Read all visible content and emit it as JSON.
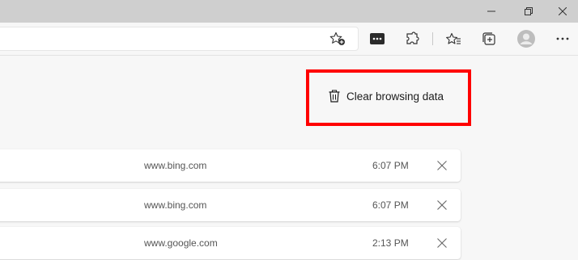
{
  "window_controls": {
    "minimize": "minimize-icon",
    "restore": "restore-icon",
    "close": "close-icon"
  },
  "toolbar": {
    "icons": [
      "favorite-add-icon",
      "password-manager-icon",
      "extensions-icon",
      "favorites-icon",
      "collections-icon",
      "profile-avatar-icon",
      "more-menu-icon"
    ]
  },
  "page": {
    "clear_label": "Clear browsing data"
  },
  "history": [
    {
      "domain": "www.bing.com",
      "time": "6:07 PM"
    },
    {
      "domain": "www.bing.com",
      "time": "6:07 PM"
    },
    {
      "domain": "www.google.com",
      "time": "2:13 PM"
    }
  ],
  "colors": {
    "highlight": "#ff0000",
    "titlebar": "#cfcfcf",
    "background": "#f7f7f7"
  }
}
